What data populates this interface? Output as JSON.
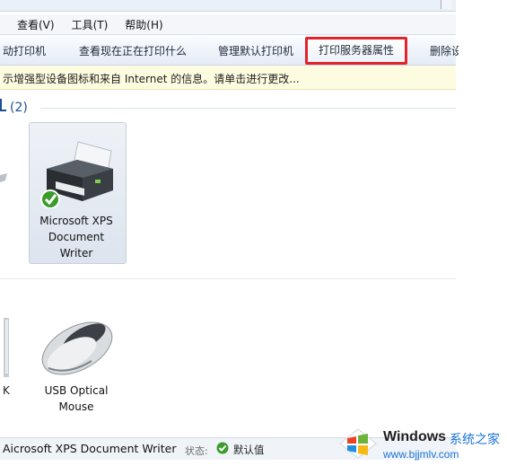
{
  "menu": [
    "查看(V)",
    "工具(T)",
    "帮助(H)"
  ],
  "commands": {
    "add_printer": "动打印机",
    "see_printing": "查看现在正在打印什么",
    "manage_default": "管理默认打印机",
    "server_props": "打印服务器属性",
    "remove": "删除设"
  },
  "infobar": "示增强型设备图标和来自 Internet 的信息。请单击进行更改...",
  "group": {
    "title": "(2)"
  },
  "devices": {
    "printer_label_lines": [
      "Microsoft XPS",
      "Document",
      "Writer"
    ],
    "mouse_label_lines": [
      "USB Optical",
      "Mouse"
    ],
    "partial_char": "K"
  },
  "status": {
    "device": "Aicrosoft XPS Document Writer",
    "state_label": "状态:",
    "state_value": "默认值"
  },
  "watermark": {
    "brand": "Windows",
    "brand_cn": "系统之家",
    "url": "www.bjjmlv.com"
  },
  "colors": {
    "highlight": "#e0242c",
    "accent_blue": "#1a73d8",
    "info_bg": "#fefce0"
  }
}
